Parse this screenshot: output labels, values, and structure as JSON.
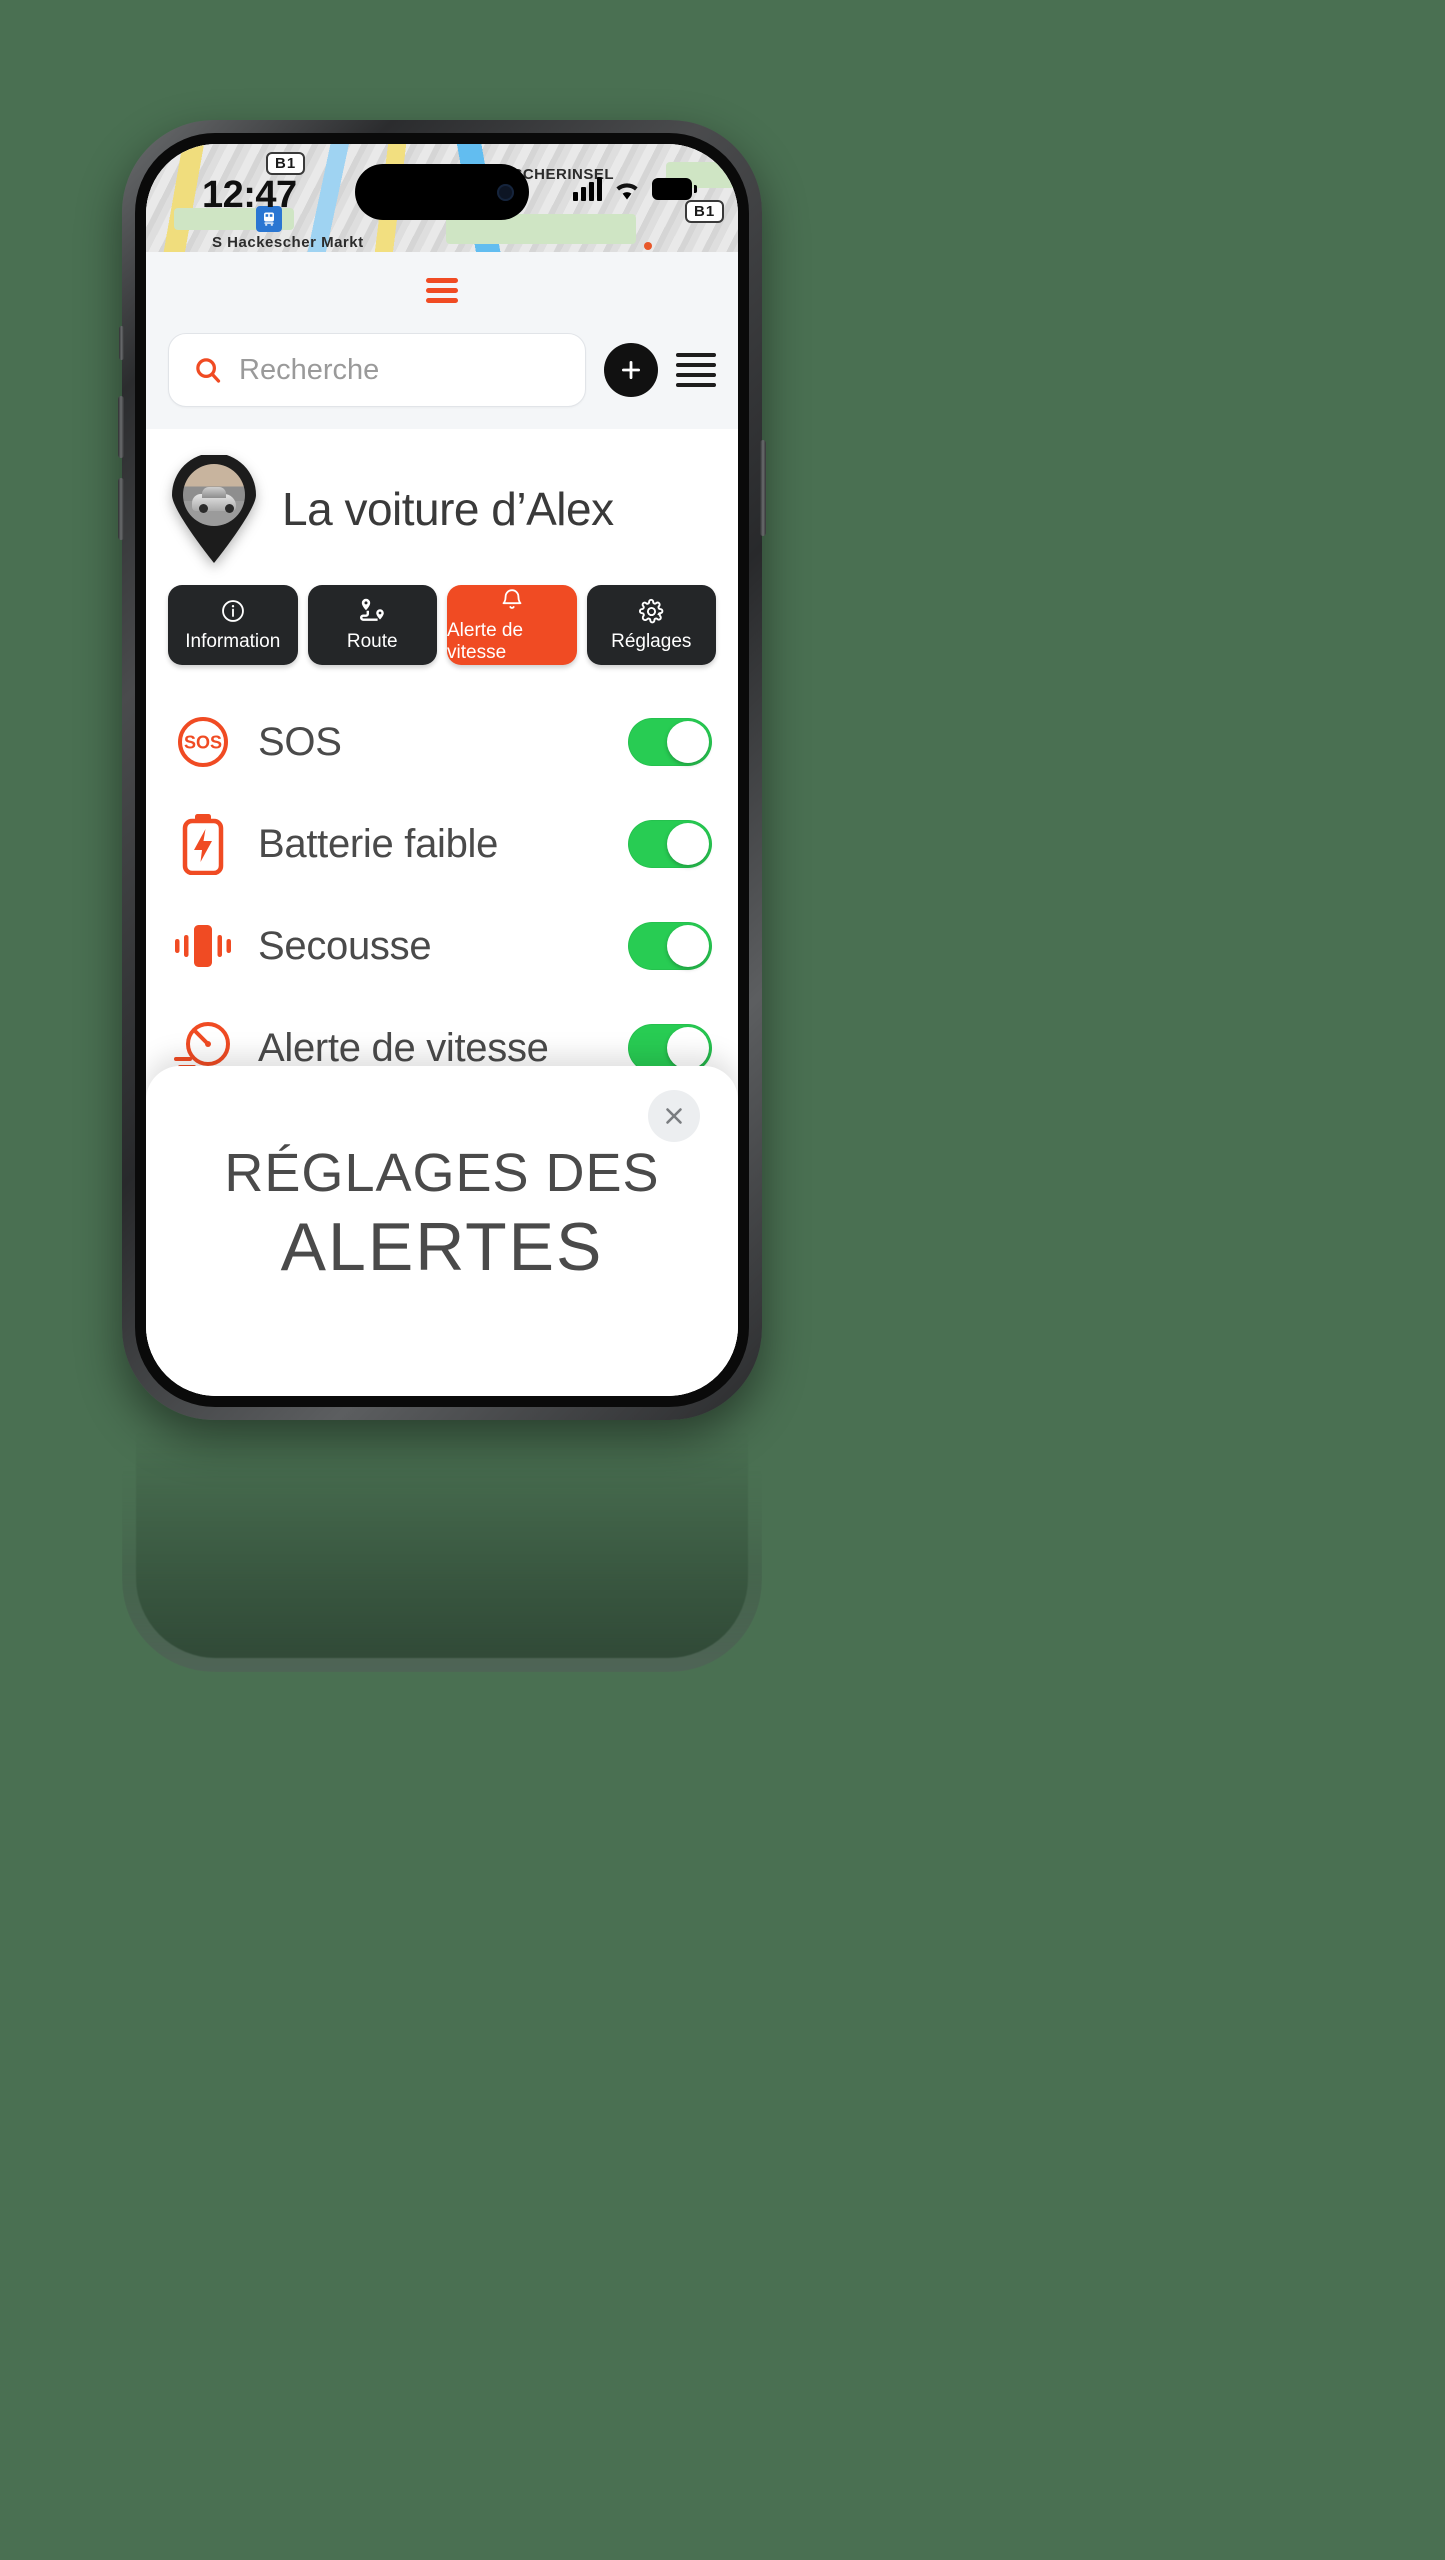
{
  "theme": {
    "background": "#4a7052",
    "accent_orange": "#f04b23",
    "toggle_green": "#28cc53",
    "tab_dark": "#242628",
    "text_gray": "#4a4a4a"
  },
  "status_bar": {
    "time": "12:47",
    "signal_icon": "cellular-bars-icon",
    "wifi_icon": "wifi-icon",
    "battery_icon": "battery-icon"
  },
  "map": {
    "labels": [
      {
        "text": "B1",
        "type": "shield"
      },
      {
        "text": "FISCHERINSEL",
        "type": "area"
      },
      {
        "text": "S Hackescher Markt",
        "type": "station"
      },
      {
        "text": "B1",
        "type": "shield"
      }
    ],
    "transit_icon": "train-icon"
  },
  "top_panel": {
    "drag_handle_icon": "hamburger-handle-icon"
  },
  "search": {
    "icon": "search-icon",
    "placeholder": "Recherche",
    "value": "",
    "add_button_icon": "plus-icon",
    "menu_button_icon": "hamburger-menu-icon"
  },
  "vehicle": {
    "avatar_icon": "car-photo-pin-icon",
    "title": "La voiture d’Alex"
  },
  "tabs": [
    {
      "label": "Information",
      "icon": "info-circle-icon",
      "active": false
    },
    {
      "label": "Route",
      "icon": "route-pins-icon",
      "active": false
    },
    {
      "label": "Alerte de vitesse",
      "icon": "bell-icon",
      "active": true
    },
    {
      "label": "Réglages",
      "icon": "gear-icon",
      "active": false
    }
  ],
  "alert_settings": [
    {
      "label": "SOS",
      "icon": "sos-circle-icon",
      "enabled": true
    },
    {
      "label": "Batterie faible",
      "icon": "low-battery-icon",
      "enabled": true
    },
    {
      "label": "Secousse",
      "icon": "vibration-icon",
      "enabled": true
    },
    {
      "label": "Alerte de vitesse",
      "icon": "speedometer-icon",
      "enabled": true
    }
  ],
  "bottom_sheet": {
    "close_icon": "close-icon",
    "title_line1": "RÉGLAGES DES",
    "title_line2": "ALERTES"
  }
}
